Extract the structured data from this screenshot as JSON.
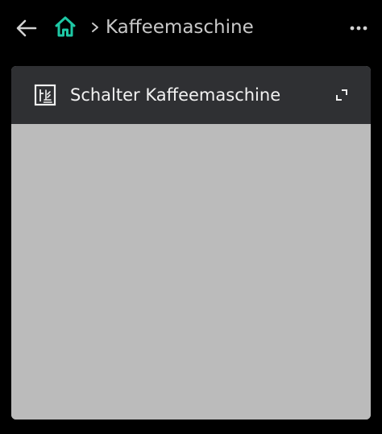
{
  "topbar": {
    "back_icon": "arrow-left-icon",
    "home_icon": "home-icon",
    "separator_icon": "chevron-right-icon",
    "breadcrumb_title": "Kaffeemaschine",
    "more_icon": "more-horizontal-icon"
  },
  "card": {
    "icon": "device-switch-icon",
    "title": "Schalter Kaffeemaschine",
    "expand_icon": "expand-icon"
  },
  "colors": {
    "background": "#000000",
    "accent": "#1ec8a5",
    "card_header": "#2f3033",
    "card_body": "#bbbbbb",
    "breadcrumb_text": "#c8c8c8"
  }
}
